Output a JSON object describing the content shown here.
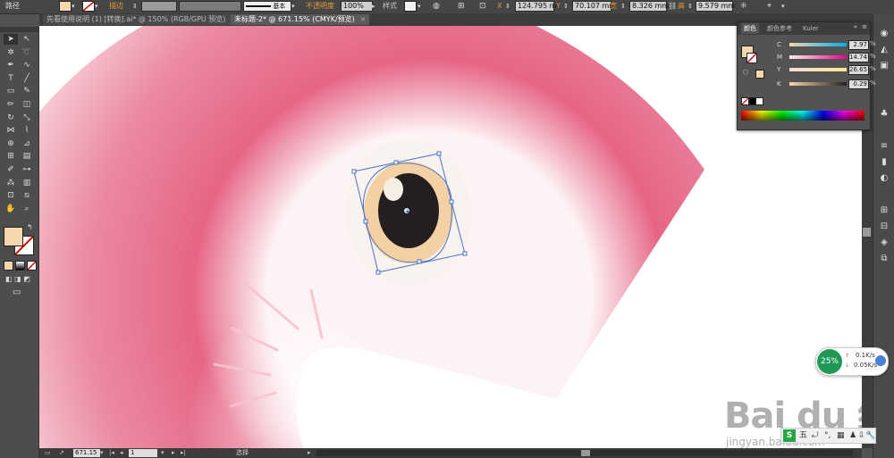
{
  "control_bar": {
    "object_type": "路径",
    "stroke_label": "描边",
    "stroke_style": "基本",
    "opacity_label": "不透明度",
    "opacity_value": "100%",
    "style_label": "样式",
    "x_label": "X",
    "x_value": "124.795 m",
    "y_label": "Y",
    "y_value": "70.107 mm",
    "w_label": "宽",
    "w_value": "8.326 mm",
    "h_label": "高",
    "h_value": "9.579 mm",
    "fill_color": "#f6d6ad"
  },
  "tabs": [
    {
      "label": "先看使用说明 (1) [转换].ai* @ 150% (RGB/GPU 预览)",
      "close": "×"
    },
    {
      "label": "未标题-2* @ 671.15% (CMYK/预览)",
      "close": "×"
    }
  ],
  "toolbar": {
    "tools": [
      "selection-icon",
      "direct-selection-icon",
      "magic-wand-icon",
      "lasso-icon",
      "pen-icon",
      "curvature-icon",
      "type-icon",
      "line-icon",
      "rectangle-icon",
      "paintbrush-icon",
      "pencil-icon",
      "eraser-icon",
      "rotate-icon",
      "scale-icon",
      "width-icon",
      "warp-icon",
      "shape-builder-icon",
      "perspective-icon",
      "mesh-icon",
      "gradient-icon",
      "eyedropper-icon",
      "blend-icon",
      "symbol-sprayer-icon",
      "graph-icon",
      "artboard-icon",
      "slice-icon",
      "hand-icon",
      "zoom-icon"
    ],
    "fill_color": "#f6d6ad"
  },
  "color_panel": {
    "tabs": [
      "颜色",
      "颜色参考",
      "Kuler"
    ],
    "channels": [
      {
        "label": "C",
        "value": "2.97",
        "unit": "%",
        "color": "#00aeef"
      },
      {
        "label": "M",
        "value": "14.74",
        "unit": "%",
        "color": "#ec008c"
      },
      {
        "label": "Y",
        "value": "26.65",
        "unit": "%",
        "color": "#fff200"
      },
      {
        "label": "K",
        "value": "0.29",
        "unit": "%",
        "color": "#231f20"
      }
    ],
    "swatch": "#f6d6ad"
  },
  "status_bar": {
    "zoom": "671.15",
    "artboard": "1",
    "tool_name": "选择"
  },
  "network_widget": {
    "percent": "25%",
    "upload": "0.1K/s",
    "download": "0.05K/s"
  },
  "ime_bar": {
    "items": [
      "五",
      "⤾",
      "°,",
      "▦",
      "♟",
      "⇩",
      "🔧"
    ]
  },
  "watermark": {
    "brand": "Bai du 经验",
    "url": "jingyan.baidu.com"
  },
  "artwork": {
    "body_color": "#e8708a",
    "eye_white": "#f8f3ee",
    "iris_color": "#f4d1a4",
    "pupil_color": "#231f20"
  }
}
